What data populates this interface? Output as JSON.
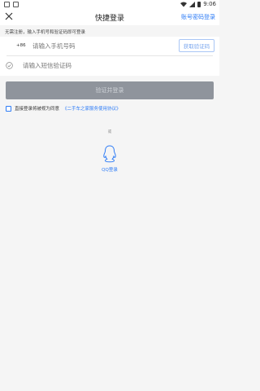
{
  "status": {
    "time": "9:06"
  },
  "nav": {
    "title": "快捷登录",
    "right_link": "账号密码登录"
  },
  "hint": "无需注册，输入手机号和验证码即可登录",
  "phone": {
    "country_code": "+86",
    "placeholder": "请输入手机号码",
    "get_code_label": "获取验证码"
  },
  "code": {
    "placeholder": "请输入短信验证码"
  },
  "login_button": "验证并登录",
  "agreement": {
    "text": "直接登录将被视为同意",
    "link": "《二手车之家服务使用协议》"
  },
  "or_text": "或",
  "qq": {
    "label": "QQ登录"
  },
  "colors": {
    "accent": "#2e7cf6",
    "button_disabled": "#8f949c"
  }
}
